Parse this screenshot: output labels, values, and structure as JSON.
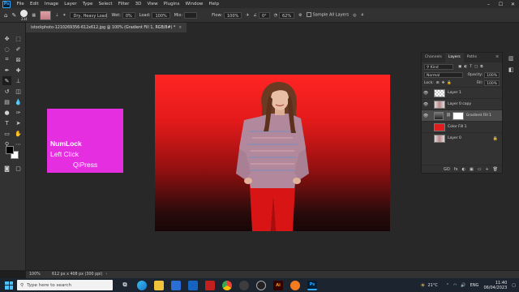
{
  "menu": {
    "items": [
      "File",
      "Edit",
      "Image",
      "Layer",
      "Type",
      "Select",
      "Filter",
      "3D",
      "View",
      "Plugins",
      "Window",
      "Help"
    ],
    "window_controls": [
      "–",
      "☐",
      "✕"
    ]
  },
  "options": {
    "brush_size": "234",
    "brush_mode": "Dry, Heavy Load",
    "wet_label": "Wet:",
    "wet_value": "0%",
    "load_label": "Load:",
    "load_value": "100%",
    "mix_label": "Mix:",
    "mix_value": "",
    "flow_label": "Flow:",
    "flow_value": "100%",
    "angle_value": "0°",
    "pct_value": "62%",
    "sample_all_layers": "Sample All Layers"
  },
  "document": {
    "tab_title": "istockphoto-1210269356-612x612.jpg @ 100% (Gradient Fill 1, RGB/8#) *",
    "close": "×",
    "zoom": "100%",
    "size_info": "612 px x 408 px (300 ppi)"
  },
  "overlay": {
    "line1": "NumLock",
    "line2": "Left Click",
    "line3": "QiPress"
  },
  "layers_panel": {
    "tabs": [
      "Channels",
      "Layers",
      "Paths"
    ],
    "kind": "Kind",
    "blend_mode": "Normal",
    "opacity_label": "Opacity:",
    "opacity_value": "100%",
    "lock_label": "Lock:",
    "fill_label": "Fill:",
    "fill_value": "100%",
    "layers": [
      {
        "name": "Layer 1"
      },
      {
        "name": "Layer 0 copy"
      },
      {
        "name": "Gradient Fill 1"
      },
      {
        "name": "Color Fill 1"
      },
      {
        "name": "Layer 0"
      }
    ],
    "footer_icons": [
      "GO",
      "fx",
      "◐",
      "▣",
      "▭",
      "+",
      "🗑"
    ]
  },
  "taskbar": {
    "search_placeholder": "Type here to search",
    "weather": "21°C",
    "lang": "ENG",
    "time": "11:40",
    "date": "06/04/2023"
  },
  "colors": {
    "accent": "#31a8ff",
    "overlay_bg": "#e42ee0",
    "panel_bg": "#323232"
  }
}
